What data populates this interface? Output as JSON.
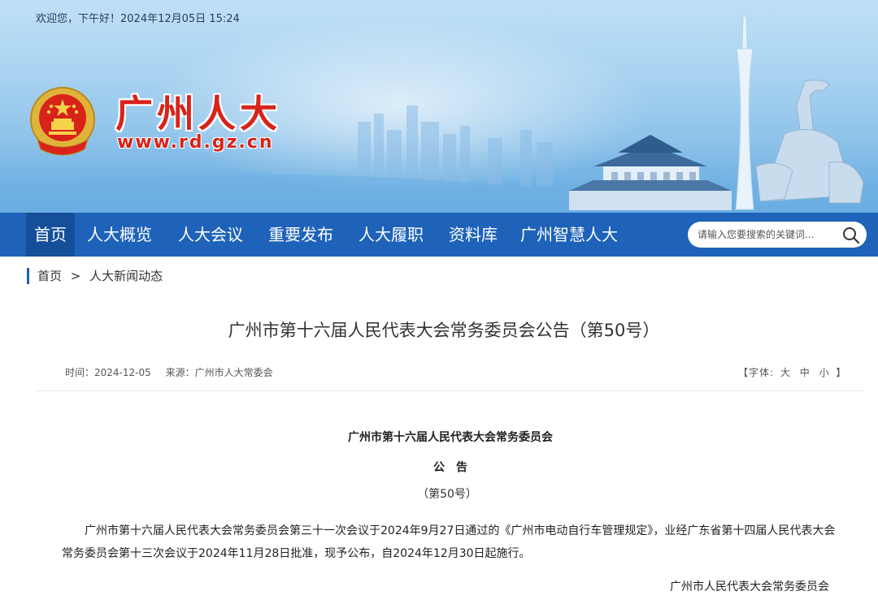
{
  "header": {
    "welcome": "欢迎您，下午好！2024年12月05日 15:24",
    "site_name": "广州人大",
    "site_url": "www.rd.gz.cn",
    "emblem": "national-emblem"
  },
  "nav": {
    "items": [
      {
        "label": "首页",
        "active": true
      },
      {
        "label": "人大概览"
      },
      {
        "label": "人大会议"
      },
      {
        "label": "重要发布"
      },
      {
        "label": "人大履职"
      },
      {
        "label": "资料库"
      },
      {
        "label": "广州智慧人大"
      }
    ],
    "search_placeholder": "请输入您要搜索的关键词...",
    "search_icon": "magnifier-icon"
  },
  "breadcrumb": {
    "home": "首页",
    "separator": ">",
    "current": "人大新闻动态"
  },
  "article": {
    "title": "广州市第十六届人民代表大会常务委员会公告（第50号）",
    "time_label": "时间：2024-12-05",
    "source_label": "来源：广州市人大常委会",
    "font_size_prefix": "【字体:",
    "font_size_options": [
      "大",
      "中",
      "小"
    ],
    "font_size_suffix": "】",
    "doc_issuer": "广州市第十六届人民代表大会常务委员会",
    "doc_type": "公　告",
    "doc_number": "（第50号）",
    "paragraph": "广州市第十六届人民代表大会常务委员会第三十一次会议于2024年9月27日通过的《广州市电动自行车管理规定》，业经广东省第十四届人民代表大会常务委员会第十三次会议于2024年11月28日批准，现予公布，自2024年12月30日起施行。",
    "signer": "广州市人民代表大会常务委员会"
  },
  "colors": {
    "nav_bg": "#1e63b9",
    "nav_active": "#154f99",
    "brand_red": "#d8231b"
  }
}
